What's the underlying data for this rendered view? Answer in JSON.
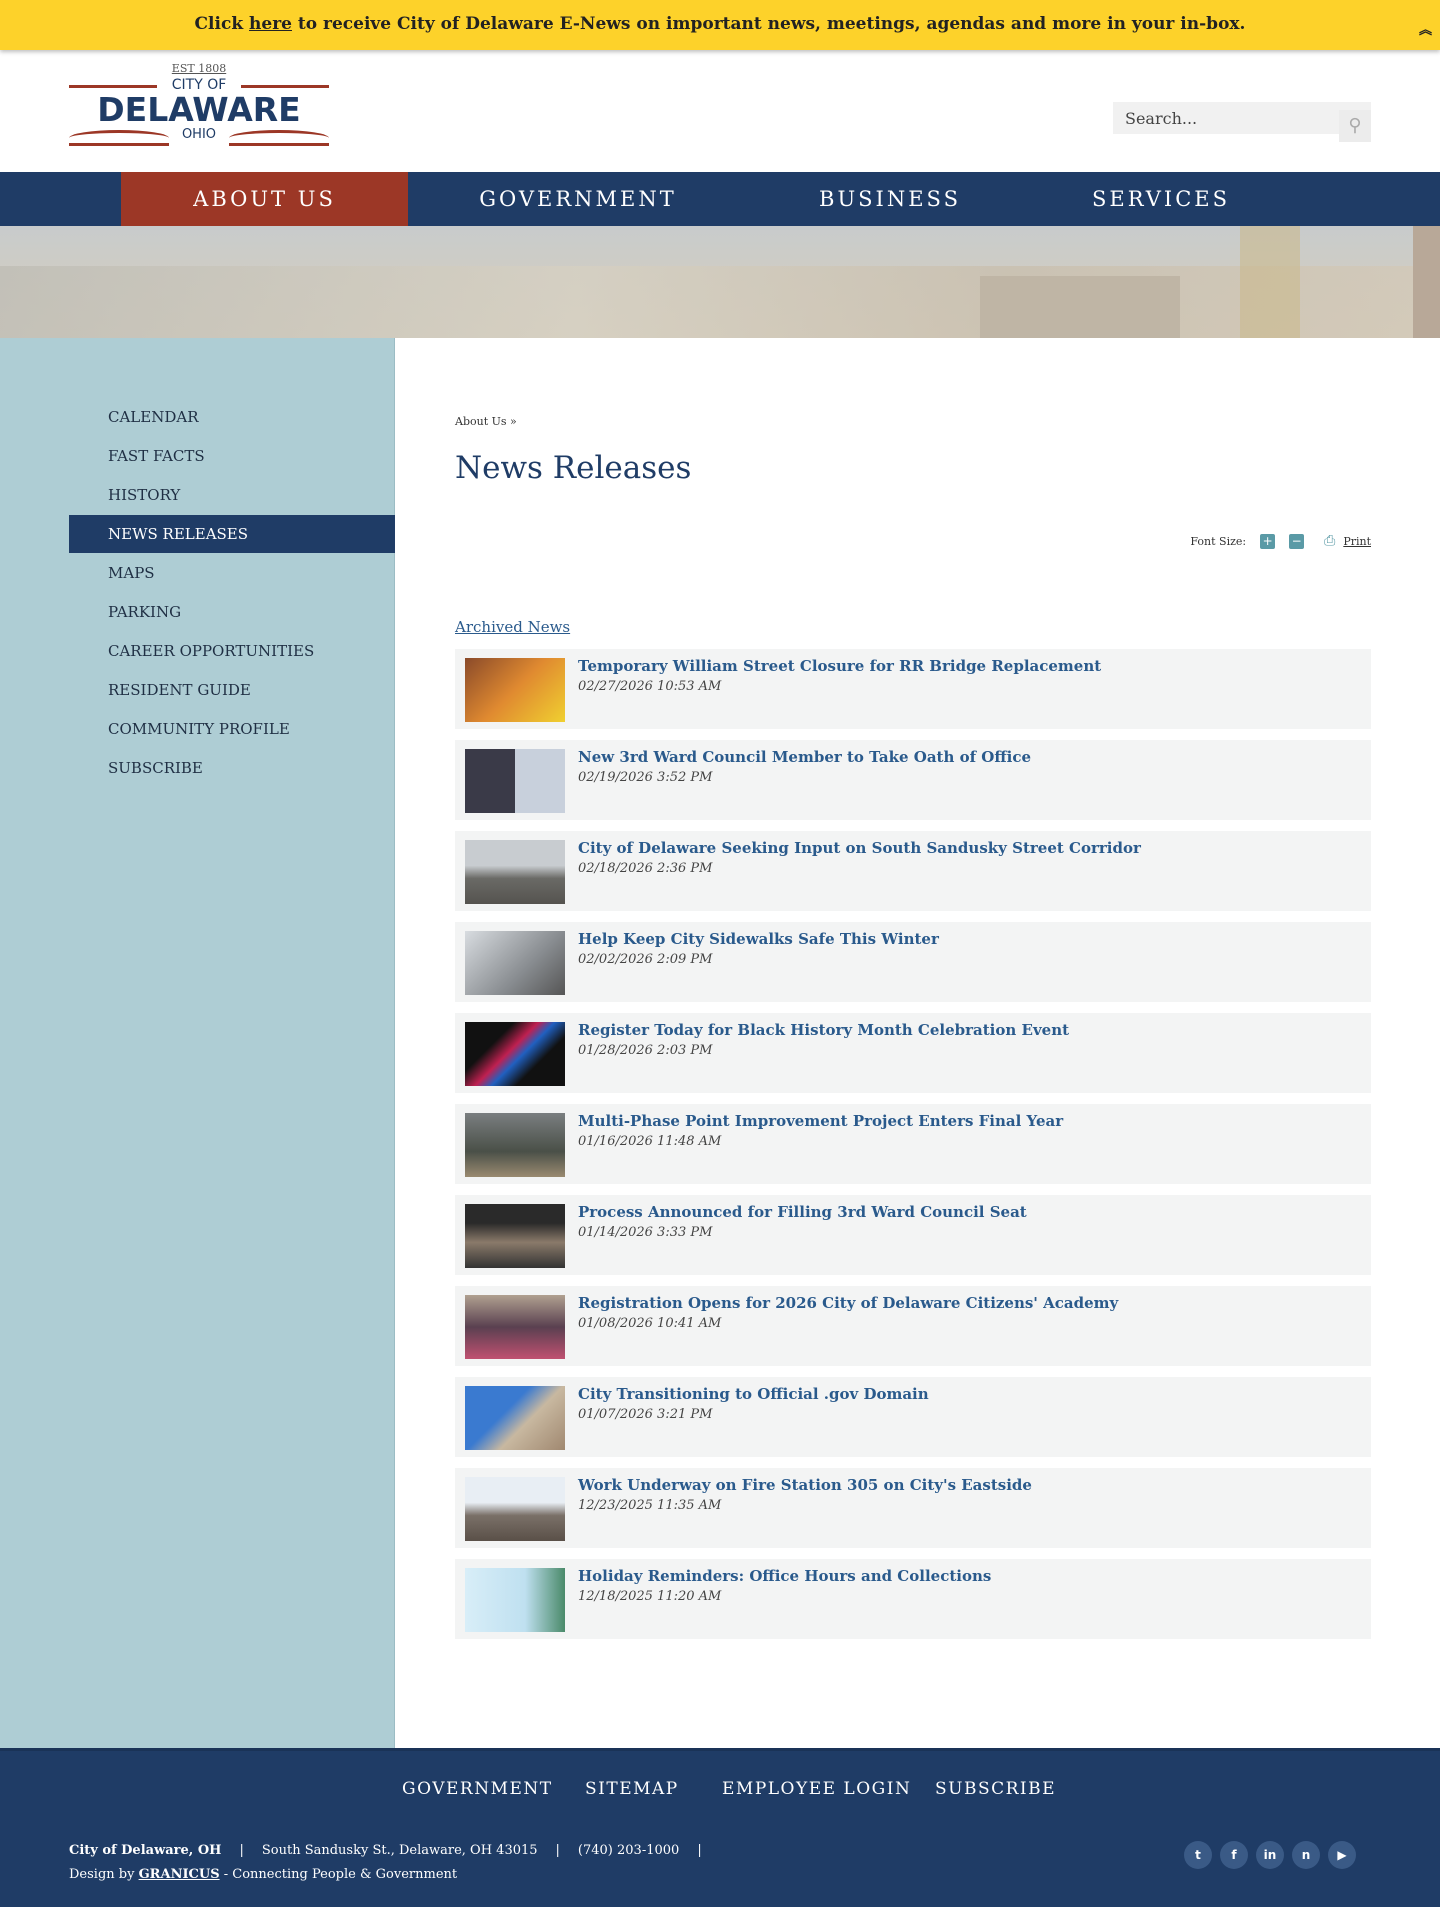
{
  "banner": {
    "pre": "Click ",
    "link": "here",
    "post": " to receive City of Delaware E-News on important news, meetings, agendas and more in your in-box.",
    "collapse_icon": "double-chevron-up"
  },
  "logo": {
    "est": "EST 1808",
    "city_of": "CITY OF",
    "name": "DELAWARE",
    "state": "OHIO"
  },
  "search": {
    "placeholder": "Search...",
    "icon": "magnifier"
  },
  "nav": [
    {
      "label": "ABOUT US",
      "active": true
    },
    {
      "label": "GOVERNMENT"
    },
    {
      "label": "BUSINESS"
    },
    {
      "label": "SERVICES"
    }
  ],
  "sidebar": [
    {
      "label": "CALENDAR"
    },
    {
      "label": "FAST FACTS"
    },
    {
      "label": "HISTORY"
    },
    {
      "label": "NEWS RELEASES",
      "active": true
    },
    {
      "label": "MAPS"
    },
    {
      "label": "PARKING"
    },
    {
      "label": "CAREER OPPORTUNITIES"
    },
    {
      "label": "RESIDENT GUIDE"
    },
    {
      "label": "COMMUNITY PROFILE"
    },
    {
      "label": "SUBSCRIBE"
    }
  ],
  "breadcrumb": "About Us »",
  "page_title": "News Releases",
  "tools": {
    "font_size_label": "Font Size:",
    "increase": "+",
    "decrease": "−",
    "print": "Print"
  },
  "archived_link": "Archived News",
  "news": [
    {
      "title": "Temporary William Street Closure for RR Bridge Replacement",
      "date": "02/27/2026 10:53 AM"
    },
    {
      "title": "New 3rd Ward Council Member to Take Oath of Office",
      "date": "02/19/2026 3:52 PM"
    },
    {
      "title": "City of Delaware Seeking Input on South Sandusky Street Corridor",
      "date": "02/18/2026 2:36 PM"
    },
    {
      "title": "Help Keep City Sidewalks Safe This Winter",
      "date": "02/02/2026 2:09 PM"
    },
    {
      "title": "Register Today for Black History Month Celebration Event",
      "date": "01/28/2026 2:03 PM"
    },
    {
      "title": "Multi-Phase Point Improvement Project Enters Final Year",
      "date": "01/16/2026 11:48 AM"
    },
    {
      "title": "Process Announced for Filling 3rd Ward Council Seat",
      "date": "01/14/2026 3:33 PM"
    },
    {
      "title": "Registration Opens for 2026 City of Delaware Citizens' Academy",
      "date": "01/08/2026 10:41 AM"
    },
    {
      "title": "City Transitioning to Official .gov Domain",
      "date": "01/07/2026 3:21 PM"
    },
    {
      "title": "Work Underway on Fire Station 305 on City's Eastside",
      "date": "12/23/2025 11:35 AM"
    },
    {
      "title": "Holiday Reminders: Office Hours and Collections",
      "date": "12/18/2025 11:20 AM"
    }
  ],
  "footer": {
    "links": [
      "GOVERNMENT",
      "SITEMAP",
      "EMPLOYEE LOGIN",
      "SUBSCRIBE"
    ],
    "org": "City of Delaware, OH",
    "address": "South Sandusky St., Delaware, OH 43015",
    "phone": "(740) 203-1000",
    "sep": "|",
    "design_pre": "Design by ",
    "design_link": "GRANICUS",
    "design_post": " - Connecting People & Government",
    "social": [
      {
        "icon": "twitter",
        "glyph": "t"
      },
      {
        "icon": "facebook",
        "glyph": "f"
      },
      {
        "icon": "linkedin",
        "glyph": "in"
      },
      {
        "icon": "nextdoor",
        "glyph": "n"
      },
      {
        "icon": "youtube",
        "glyph": "▶"
      }
    ]
  },
  "colors": {
    "navy": "#1f3c66",
    "red": "#9c3726",
    "yellow": "#fdd22a",
    "sidebar": "#aecdd4",
    "link": "#2a5a8c"
  }
}
